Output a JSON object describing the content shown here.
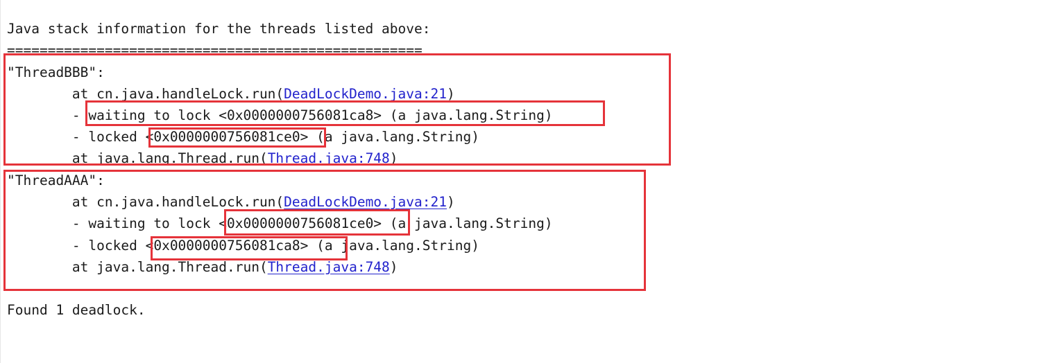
{
  "console": {
    "header": "Java stack information for the threads listed above:",
    "separator": "===================================================",
    "threads": [
      {
        "name": "\"ThreadBBB\":",
        "frame1_prefix": "        at cn.java.handleLock.run(",
        "frame1_link": "DeadLockDemo.java:21",
        "frame1_suffix": ")",
        "waiting_prefix": "        - ",
        "waiting_text": "waiting to lock <0x0000000756081ca8> (a java.lang.String)",
        "locked_prefix": "        - locked ",
        "locked_addr": "<0x0000000756081ce0>",
        "locked_suffix": " (a java.lang.String)",
        "frame2_prefix": "        at java.lang.Thread.run(",
        "frame2_link": "Thread.java:748",
        "frame2_suffix": ")"
      },
      {
        "name": "\"ThreadAAA\":",
        "frame1_prefix": "        at cn.java.handleLock.run(",
        "frame1_link": "DeadLockDemo.java:21",
        "frame1_suffix": ")",
        "waiting_prefix": "        - waiting to lock ",
        "waiting_addr": "<0x0000000756081ce0>",
        "waiting_suffix": " (a java.lang.String)",
        "locked_prefix": "        - locked ",
        "locked_addr": "<0x0000000756081ca8>",
        "locked_suffix": " (a java.lang.String)",
        "frame2_prefix": "        at java.lang.Thread.run(",
        "frame2_link": "Thread.java:748",
        "frame2_suffix": ")"
      }
    ],
    "footer": "Found 1 deadlock."
  },
  "colors": {
    "highlight": "#e5333a",
    "link": "#2222cc",
    "text": "#1a1a1a"
  }
}
